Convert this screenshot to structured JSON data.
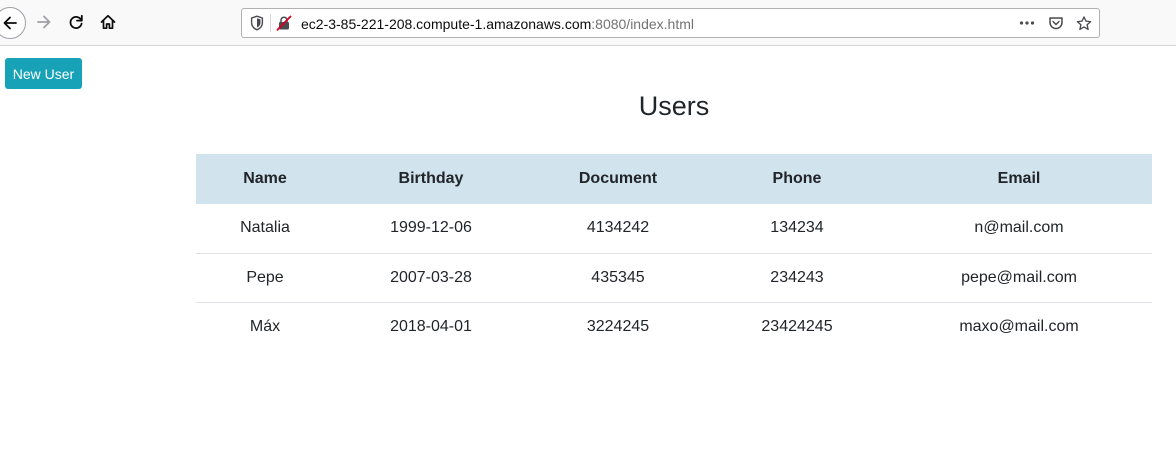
{
  "browser": {
    "url_host": "ec2-3-85-221-208.compute-1.amazonaws.com",
    "url_rest": ":8080/index.html"
  },
  "page": {
    "new_user_label": "New User",
    "title": "Users"
  },
  "table": {
    "headers": [
      "Name",
      "Birthday",
      "Document",
      "Phone",
      "Email"
    ],
    "rows": [
      [
        "Natalia",
        "1999-12-06",
        "4134242",
        "134234",
        "n@mail.com"
      ],
      [
        "Pepe",
        "2007-03-28",
        "435345",
        "234243",
        "pepe@mail.com"
      ],
      [
        "Máx",
        "2018-04-01",
        "3224245",
        "23424245",
        "maxo@mail.com"
      ]
    ]
  },
  "colors": {
    "button_bg": "#17a2b8",
    "header_bg": "#d1e3ec"
  }
}
